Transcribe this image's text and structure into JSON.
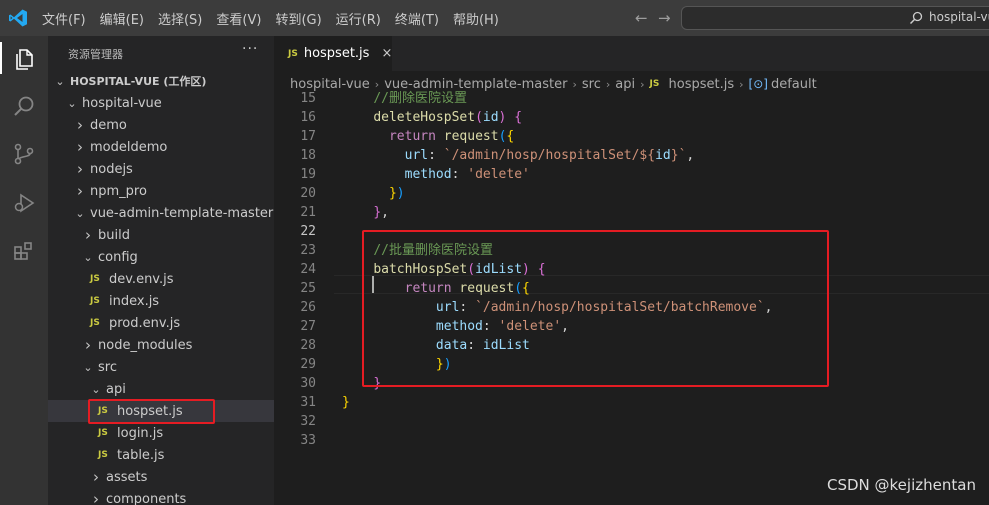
{
  "menu": [
    "文件(F)",
    "编辑(E)",
    "选择(S)",
    "查看(V)",
    "转到(G)",
    "运行(R)",
    "终端(T)",
    "帮助(H)"
  ],
  "nav": {
    "back": "←",
    "forward": "→"
  },
  "search": {
    "text": "hospital-vue"
  },
  "sidebar": {
    "header": "资源管理器",
    "more": "···",
    "tree": [
      {
        "label": "HOSPITAL-VUE (工作区)",
        "depth": 0,
        "type": "folder",
        "open": true,
        "root": true
      },
      {
        "label": "hospital-vue",
        "depth": 1,
        "type": "folder",
        "open": true
      },
      {
        "label": "demo",
        "depth": 2,
        "type": "folder",
        "open": false
      },
      {
        "label": "modeldemo",
        "depth": 2,
        "type": "folder",
        "open": false
      },
      {
        "label": "nodejs",
        "depth": 2,
        "type": "folder",
        "open": false
      },
      {
        "label": "npm_pro",
        "depth": 2,
        "type": "folder",
        "open": false
      },
      {
        "label": "vue-admin-template-master",
        "depth": 2,
        "type": "folder",
        "open": true
      },
      {
        "label": "build",
        "depth": 3,
        "type": "folder",
        "open": false
      },
      {
        "label": "config",
        "depth": 3,
        "type": "folder",
        "open": true
      },
      {
        "label": "dev.env.js",
        "depth": 4,
        "type": "js"
      },
      {
        "label": "index.js",
        "depth": 4,
        "type": "js"
      },
      {
        "label": "prod.env.js",
        "depth": 4,
        "type": "js"
      },
      {
        "label": "node_modules",
        "depth": 3,
        "type": "folder",
        "open": false
      },
      {
        "label": "src",
        "depth": 3,
        "type": "folder",
        "open": true
      },
      {
        "label": "api",
        "depth": 4,
        "type": "folder",
        "open": true
      },
      {
        "label": "hospset.js",
        "depth": 5,
        "type": "js",
        "selected": true
      },
      {
        "label": "login.js",
        "depth": 5,
        "type": "js"
      },
      {
        "label": "table.js",
        "depth": 5,
        "type": "js"
      },
      {
        "label": "assets",
        "depth": 4,
        "type": "folder",
        "open": false
      },
      {
        "label": "components",
        "depth": 4,
        "type": "folder",
        "open": false
      }
    ]
  },
  "tab": {
    "badge": "JS",
    "label": "hospset.js",
    "close": "×"
  },
  "breadcrumb": {
    "parts": [
      "hospital-vue",
      "vue-admin-template-master",
      "src",
      "api"
    ],
    "file_badge": "JS",
    "file": "hospset.js",
    "symbol_icon": "[⊙]",
    "symbol": "default"
  },
  "code": {
    "current_line": "22",
    "lines": [
      {
        "n": "15",
        "tokens": [
          [
            "    ",
            ""
          ],
          [
            "//删除医院设置",
            "cmt"
          ]
        ]
      },
      {
        "n": "16",
        "tokens": [
          [
            "    ",
            ""
          ],
          [
            "deleteHospSet",
            "fn"
          ],
          [
            "(",
            "b2"
          ],
          [
            "id",
            "var"
          ],
          [
            ")",
            "b2"
          ],
          [
            " ",
            ""
          ],
          [
            "{",
            "b2"
          ]
        ]
      },
      {
        "n": "17",
        "tokens": [
          [
            "      ",
            ""
          ],
          [
            "return",
            "kw"
          ],
          [
            " ",
            ""
          ],
          [
            "request",
            "fn"
          ],
          [
            "(",
            "b3"
          ],
          [
            "{",
            "b1"
          ]
        ]
      },
      {
        "n": "18",
        "tokens": [
          [
            "        ",
            ""
          ],
          [
            "url",
            "var"
          ],
          [
            ": ",
            ""
          ],
          [
            "`/admin/hosp/hospitalSet/${",
            "str"
          ],
          [
            "id",
            "var"
          ],
          [
            "}`",
            "str"
          ],
          [
            ",",
            ""
          ]
        ]
      },
      {
        "n": "19",
        "tokens": [
          [
            "        ",
            ""
          ],
          [
            "method",
            "var"
          ],
          [
            ": ",
            ""
          ],
          [
            "'delete'",
            "str"
          ]
        ]
      },
      {
        "n": "20",
        "tokens": [
          [
            "      ",
            ""
          ],
          [
            "}",
            "b1"
          ],
          [
            ")",
            "b3"
          ]
        ]
      },
      {
        "n": "21",
        "tokens": [
          [
            "    ",
            ""
          ],
          [
            "}",
            "b2"
          ],
          [
            ",",
            ""
          ]
        ]
      },
      {
        "n": "22",
        "tokens": [
          [
            "",
            ""
          ]
        ]
      },
      {
        "n": "23",
        "tokens": [
          [
            "    ",
            ""
          ],
          [
            "//批量删除医院设置",
            "cmt"
          ]
        ]
      },
      {
        "n": "24",
        "tokens": [
          [
            "    ",
            ""
          ],
          [
            "batchHospSet",
            "fn"
          ],
          [
            "(",
            "b2"
          ],
          [
            "idList",
            "var"
          ],
          [
            ")",
            "b2"
          ],
          [
            " ",
            ""
          ],
          [
            "{",
            "b2"
          ]
        ]
      },
      {
        "n": "25",
        "tokens": [
          [
            "        ",
            ""
          ],
          [
            "return",
            "kw"
          ],
          [
            " ",
            ""
          ],
          [
            "request",
            "fn"
          ],
          [
            "(",
            "b3"
          ],
          [
            "{",
            "b1"
          ]
        ]
      },
      {
        "n": "26",
        "tokens": [
          [
            "            ",
            ""
          ],
          [
            "url",
            "var"
          ],
          [
            ": ",
            ""
          ],
          [
            "`/admin/hosp/hospitalSet/batchRemove`",
            "str"
          ],
          [
            ",",
            ""
          ]
        ]
      },
      {
        "n": "27",
        "tokens": [
          [
            "            ",
            ""
          ],
          [
            "method",
            "var"
          ],
          [
            ": ",
            ""
          ],
          [
            "'delete'",
            "str"
          ],
          [
            ",",
            ""
          ]
        ]
      },
      {
        "n": "28",
        "tokens": [
          [
            "            ",
            ""
          ],
          [
            "data",
            "var"
          ],
          [
            ": ",
            ""
          ],
          [
            "idList",
            "var"
          ]
        ]
      },
      {
        "n": "29",
        "tokens": [
          [
            "            ",
            ""
          ],
          [
            "}",
            "b1"
          ],
          [
            ")",
            "b3"
          ]
        ]
      },
      {
        "n": "30",
        "tokens": [
          [
            "    ",
            ""
          ],
          [
            "}",
            "b2"
          ]
        ]
      },
      {
        "n": "31",
        "tokens": [
          [
            "",
            ""
          ],
          [
            "}",
            "b1"
          ]
        ]
      },
      {
        "n": "32",
        "tokens": [
          [
            "",
            ""
          ]
        ]
      },
      {
        "n": "33",
        "tokens": [
          [
            "",
            ""
          ]
        ]
      }
    ]
  },
  "watermark": "CSDN @kejizhentan",
  "colors": {
    "highlight_box": "#e51c23",
    "activity_bar": "#333333",
    "sidebar": "#252526",
    "editor": "#1e1e1e"
  }
}
